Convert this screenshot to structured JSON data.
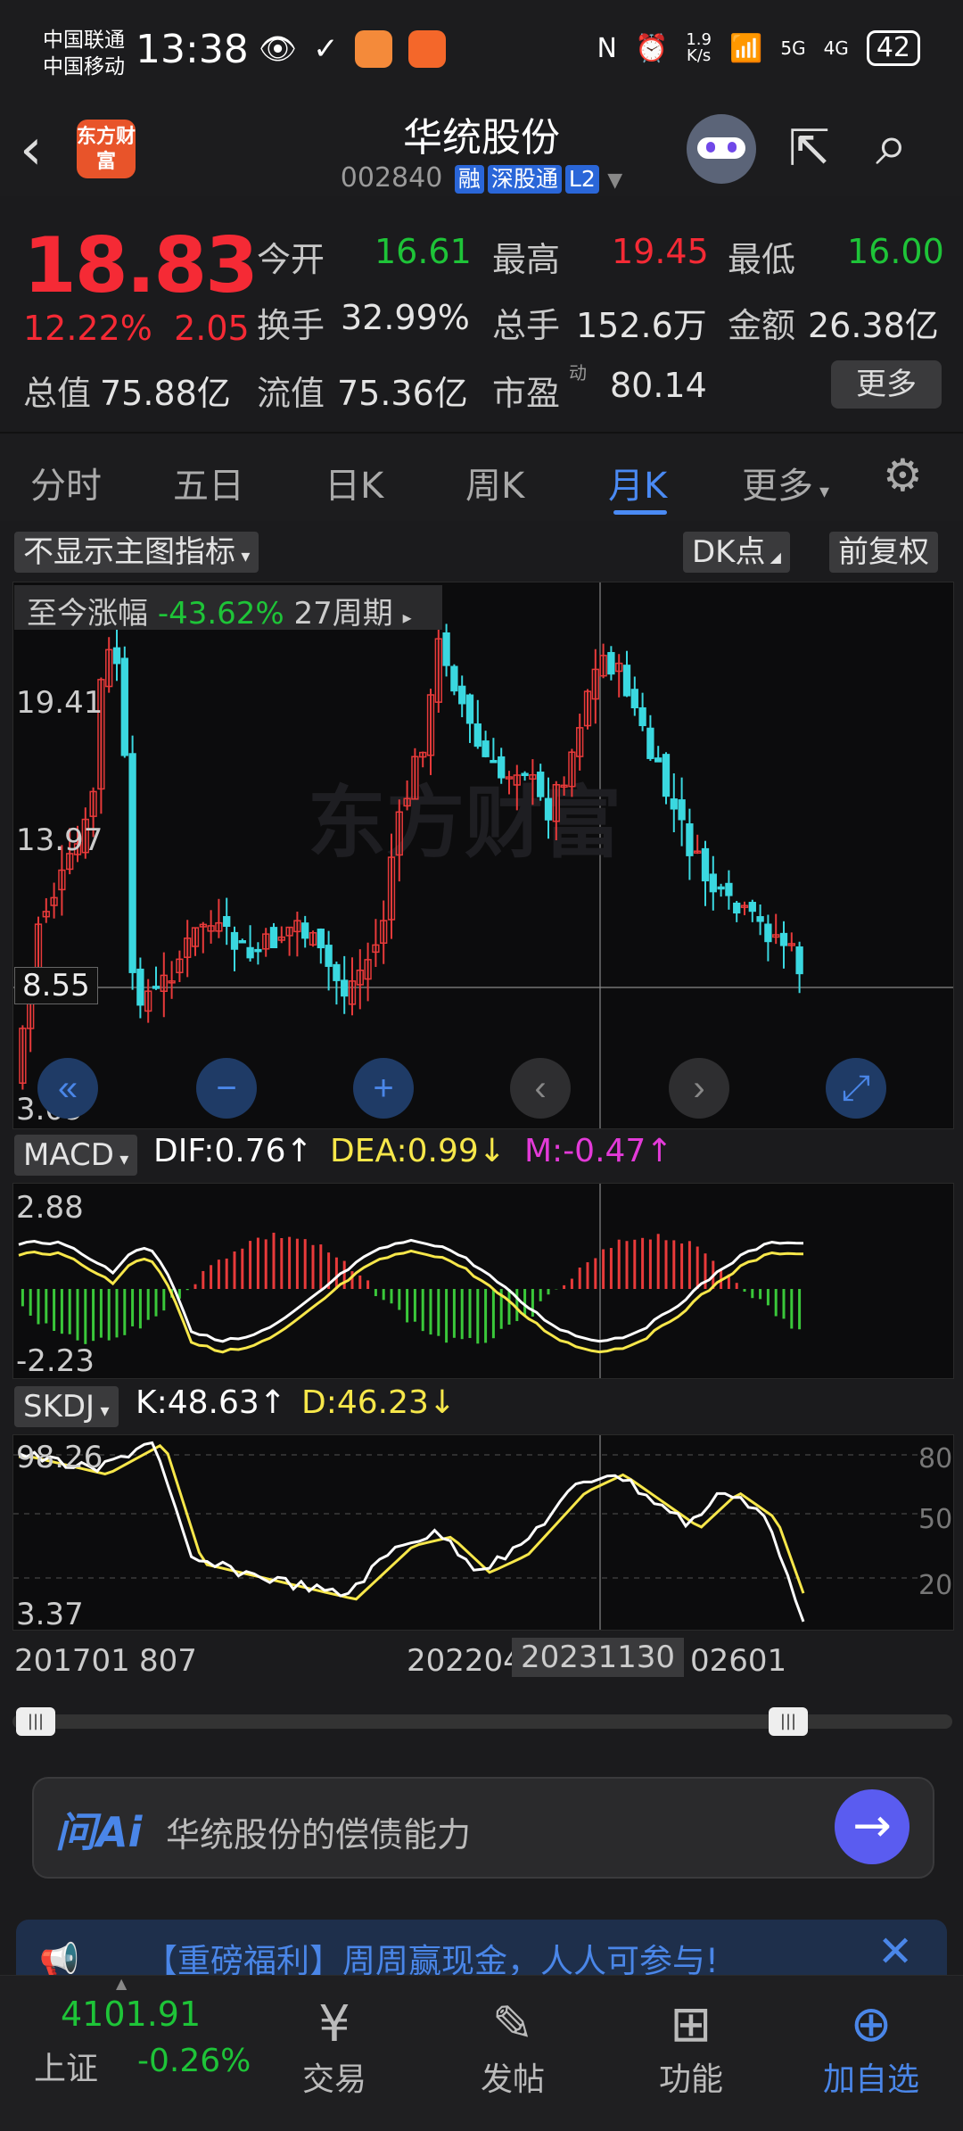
{
  "status_bar": {
    "carrier1": "中国联通",
    "carrier2": "中国移动",
    "time": "13:38",
    "net_speed_top": "1.9",
    "net_speed_bottom": "K/s",
    "wifi_label": "6",
    "sig1": "5G",
    "sig2": "4G",
    "battery": "42"
  },
  "header": {
    "logo_text": "东方财富",
    "stock_name": "华统股份",
    "stock_code": "002840",
    "tags": [
      "融",
      "深股通",
      "L2"
    ]
  },
  "quote": {
    "price": "18.83",
    "change_pct": "12.22%",
    "change_abs": "2.05",
    "open_label": "今开",
    "open": "16.61",
    "high_label": "最高",
    "high": "19.45",
    "low_label": "最低",
    "low": "16.00",
    "turnover_label": "换手",
    "turnover": "32.99%",
    "volume_label": "总手",
    "volume": "152.6万",
    "amount_label": "金额",
    "amount": "26.38亿",
    "mktcap_label": "总值",
    "mktcap": "75.88亿",
    "float_label": "流值",
    "float": "75.36亿",
    "pe_label": "市盈",
    "pe_sup": "动",
    "pe": "80.14",
    "more": "更多"
  },
  "tabs": [
    "分时",
    "五日",
    "日K",
    "周K",
    "月K",
    "更多"
  ],
  "active_tab": "月K",
  "chart_controls": {
    "indicator_select": "不显示主图指标",
    "dk_label": "DK点",
    "fq_label": "前复权",
    "range_label": "至今涨幅",
    "range_value": "-43.62%",
    "range_period": "27周期"
  },
  "chart_data": {
    "type": "candlestick",
    "y_ticks": [
      "19.41",
      "13.97",
      "8.55",
      "3.09"
    ],
    "x_ticks": [
      "201701",
      "807",
      "202204",
      "20231130",
      "02601"
    ],
    "crosshair_x_label": "20231130",
    "macd": {
      "name": "MACD",
      "dif": "DIF:0.76↑",
      "dea": "DEA:0.99↓",
      "m": "M:-0.47↑",
      "y_top": "2.88",
      "y_bottom": "-2.23"
    },
    "skdj": {
      "name": "SKDJ",
      "k": "K:48.63↑",
      "d": "D:46.23↓",
      "y_top": "98.26",
      "y_bottom": "3.37",
      "levels": [
        "80",
        "50",
        "20"
      ]
    }
  },
  "ask_bar": {
    "logo": "问Ai",
    "text": "华统股份的偿债能力"
  },
  "banner": {
    "text": "【重磅福利】周周赢现金，人人可参与!"
  },
  "bottom_nav": {
    "index_value": "4101.91",
    "index_name": "上证",
    "index_change": "-0.26%",
    "items": [
      "交易",
      "发帖",
      "功能",
      "加自选"
    ]
  }
}
